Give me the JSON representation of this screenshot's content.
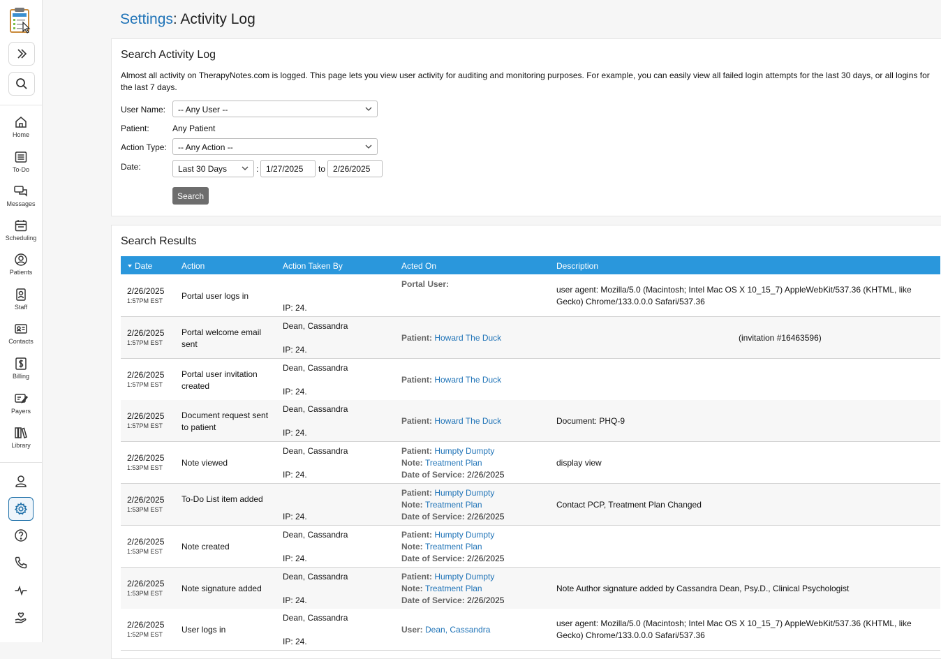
{
  "sidebar": {
    "nav": [
      {
        "label": "Home",
        "icon": "home-icon"
      },
      {
        "label": "To-Do",
        "icon": "todo-icon"
      },
      {
        "label": "Messages",
        "icon": "messages-icon"
      },
      {
        "label": "Scheduling",
        "icon": "calendar-icon"
      },
      {
        "label": "Patients",
        "icon": "patients-icon"
      },
      {
        "label": "Staff",
        "icon": "staff-icon"
      },
      {
        "label": "Contacts",
        "icon": "contacts-icon"
      },
      {
        "label": "Billing",
        "icon": "billing-icon"
      },
      {
        "label": "Payers",
        "icon": "payers-icon"
      },
      {
        "label": "Library",
        "icon": "library-icon"
      }
    ]
  },
  "header": {
    "crumb": "Settings",
    "title": ": Activity Log"
  },
  "search": {
    "title": "Search Activity Log",
    "description": "Almost all activity on TherapyNotes.com is logged. This page lets you view user activity for auditing and monitoring purposes. For example, you can easily view all failed login attempts for the last 30 days, or all logins for the last 7 days.",
    "user_label": "User Name:",
    "user_value": "-- Any User --",
    "patient_label": "Patient:",
    "patient_value": "Any Patient",
    "action_label": "Action Type:",
    "action_value": "-- Any Action --",
    "date_label": "Date:",
    "date_range": "Last 30 Days",
    "date_colon": ":",
    "date_from": "1/27/2025",
    "date_to_word": "to",
    "date_to": "2/26/2025",
    "button": "Search"
  },
  "results": {
    "title": "Search Results",
    "columns": {
      "date": "Date",
      "action": "Action",
      "by": "Action Taken By",
      "on": "Acted On",
      "desc": "Description"
    },
    "rows": [
      {
        "date": "2/26/2025",
        "time": "1:57PM EST",
        "action": "Portal user logs in",
        "by_name": "",
        "ip": "IP: 24.",
        "on": [
          {
            "k": "Portal User:",
            "v": ""
          }
        ],
        "desc": "user agent: Mozilla/5.0 (Macintosh; Intel Mac OS X 10_15_7) AppleWebKit/537.36 (KHTML, like Gecko) Chrome/133.0.0.0 Safari/537.36"
      },
      {
        "date": "2/26/2025",
        "time": "1:57PM EST",
        "action": "Portal welcome email sent",
        "by_name": "Dean, Cassandra",
        "ip": "IP: 24.",
        "on": [
          {
            "k": "Patient:",
            "v": "Howard The Duck"
          }
        ],
        "desc": "(invitation #16463596)"
      },
      {
        "date": "2/26/2025",
        "time": "1:57PM EST",
        "action": "Portal user invitation created",
        "by_name": "Dean, Cassandra",
        "ip": "IP: 24.",
        "on": [
          {
            "k": "Patient:",
            "v": "Howard The Duck"
          }
        ],
        "desc": ""
      },
      {
        "date": "2/26/2025",
        "time": "1:57PM EST",
        "action": "Document request sent to patient",
        "by_name": "Dean, Cassandra",
        "ip": "IP: 24.",
        "on": [
          {
            "k": "Patient:",
            "v": "Howard The Duck"
          }
        ],
        "desc": "Document: PHQ-9"
      },
      {
        "date": "2/26/2025",
        "time": "1:53PM EST",
        "action": "Note viewed",
        "by_name": "Dean, Cassandra",
        "ip": "IP: 24.",
        "on": [
          {
            "k": "Patient:",
            "v": "Humpty Dumpty"
          },
          {
            "k": "Note:",
            "v": "Treatment Plan"
          },
          {
            "k": "Date of Service:",
            "v": "2/26/2025"
          }
        ],
        "desc": "display view"
      },
      {
        "date": "2/26/2025",
        "time": "1:53PM EST",
        "action": "To-Do List item added",
        "by_name": "",
        "ip": "IP: 24.",
        "on": [
          {
            "k": "Patient:",
            "v": "Humpty Dumpty"
          },
          {
            "k": "Note:",
            "v": "Treatment Plan"
          },
          {
            "k": "Date of Service:",
            "v": "2/26/2025"
          }
        ],
        "desc": "Contact PCP, Treatment Plan Changed"
      },
      {
        "date": "2/26/2025",
        "time": "1:53PM EST",
        "action": "Note created",
        "by_name": "Dean, Cassandra",
        "ip": "IP: 24.",
        "on": [
          {
            "k": "Patient:",
            "v": "Humpty Dumpty"
          },
          {
            "k": "Note:",
            "v": "Treatment Plan"
          },
          {
            "k": "Date of Service:",
            "v": "2/26/2025"
          }
        ],
        "desc": ""
      },
      {
        "date": "2/26/2025",
        "time": "1:53PM EST",
        "action": "Note signature added",
        "by_name": "Dean, Cassandra",
        "ip": "IP: 24.",
        "on": [
          {
            "k": "Patient:",
            "v": "Humpty Dumpty"
          },
          {
            "k": "Note:",
            "v": "Treatment Plan"
          },
          {
            "k": "Date of Service:",
            "v": "2/26/2025"
          }
        ],
        "desc": "Note Author signature added by Cassandra Dean, Psy.D., Clinical Psychologist"
      },
      {
        "date": "2/26/2025",
        "time": "1:52PM EST",
        "action": "User logs in",
        "by_name": "Dean, Cassandra",
        "ip": "IP: 24.",
        "on": [
          {
            "k": "User:",
            "v": "Dean, Cassandra"
          }
        ],
        "desc": "user agent: Mozilla/5.0 (Macintosh; Intel Mac OS X 10_15_7) AppleWebKit/537.36 (KHTML, like Gecko) Chrome/133.0.0.0 Safari/537.36"
      }
    ]
  }
}
